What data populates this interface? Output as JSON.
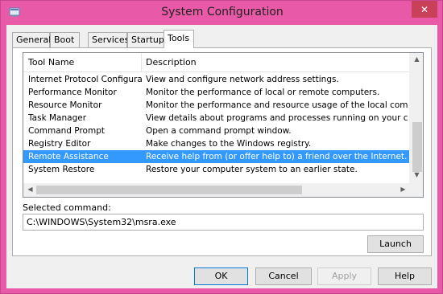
{
  "window": {
    "title": "System Configuration",
    "close_label": "✕",
    "colors": {
      "frame": "#e85aa8",
      "selection": "#3399ff"
    }
  },
  "tabs": [
    {
      "label": "General"
    },
    {
      "label": "Boot"
    },
    {
      "label": "Services"
    },
    {
      "label": "Startup"
    },
    {
      "label": "Tools",
      "active": true
    }
  ],
  "tools_list": {
    "headers": {
      "name": "Tool Name",
      "description": "Description"
    },
    "rows": [
      {
        "name": "Internet Protocol Configurat...",
        "description": "View and configure network address settings."
      },
      {
        "name": "Performance Monitor",
        "description": "Monitor the performance of local or remote computers."
      },
      {
        "name": "Resource Monitor",
        "description": "Monitor the performance and resource usage of the local computer."
      },
      {
        "name": "Task Manager",
        "description": "View details about programs and processes running on your computer."
      },
      {
        "name": "Command Prompt",
        "description": "Open a command prompt window."
      },
      {
        "name": "Registry Editor",
        "description": "Make changes to the Windows registry."
      },
      {
        "name": "Remote Assistance",
        "description": "Receive help from (or offer help to) a friend over the Internet.",
        "selected": true
      },
      {
        "name": "System Restore",
        "description": "Restore your computer system to an earlier state."
      }
    ]
  },
  "selected_command": {
    "label": "Selected command:",
    "value": "C:\\WINDOWS\\System32\\msra.exe"
  },
  "buttons": {
    "launch": "Launch",
    "ok": "OK",
    "cancel": "Cancel",
    "apply": "Apply",
    "help": "Help"
  }
}
